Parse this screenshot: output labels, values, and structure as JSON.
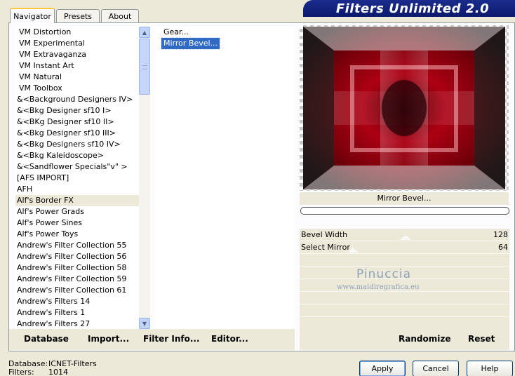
{
  "tabs": [
    {
      "label": "Navigator"
    },
    {
      "label": "Presets"
    },
    {
      "label": "About"
    }
  ],
  "banner_title": "Filters Unlimited 2.0",
  "categories": [
    {
      "label": "VM Distortion"
    },
    {
      "label": "VM Experimental"
    },
    {
      "label": "VM Extravaganza"
    },
    {
      "label": "VM Instant Art"
    },
    {
      "label": "VM Natural"
    },
    {
      "label": "VM Toolbox"
    },
    {
      "label": "&<Background Designers IV>"
    },
    {
      "label": "&<Bkg Designer sf10 I>"
    },
    {
      "label": "&<BKg Designer sf10 II>"
    },
    {
      "label": "&<Bkg Designer sf10 III>"
    },
    {
      "label": "&<Bkg Designers sf10 IV>"
    },
    {
      "label": "&<Bkg Kaleidoscope>"
    },
    {
      "label": "&<Sandflower Specials\"v\" >"
    },
    {
      "label": "[AFS IMPORT]"
    },
    {
      "label": "AFH"
    },
    {
      "label": "Alf's Border FX"
    },
    {
      "label": "Alf's Power Grads"
    },
    {
      "label": "Alf's Power Sines"
    },
    {
      "label": "Alf's Power Toys"
    },
    {
      "label": "Andrew's Filter Collection 55"
    },
    {
      "label": "Andrew's Filter Collection 56"
    },
    {
      "label": "Andrew's Filter Collection 58"
    },
    {
      "label": "Andrew's Filter Collection 59"
    },
    {
      "label": "Andrew's Filter Collection 61"
    },
    {
      "label": "Andrew's Filters 14"
    },
    {
      "label": "Andrew's Filters 1"
    },
    {
      "label": "Andrew's Filters 27"
    }
  ],
  "selected_category_index": 15,
  "filters": [
    {
      "label": "Gear..."
    },
    {
      "label": "Mirror Bevel..."
    }
  ],
  "selected_filter_index": 1,
  "current_filter_name": "Mirror Bevel...",
  "params": [
    {
      "label": "Bevel Width",
      "value": "128",
      "fraction": 0.5
    },
    {
      "label": "Select Mirror",
      "value": "64",
      "fraction": 0.0
    }
  ],
  "watermark": {
    "name": "Pinuccia",
    "site": "www.maidiregrafica.eu"
  },
  "toolbar": {
    "database": "Database",
    "import": "Import...",
    "filter_info": "Filter Info...",
    "editor": "Editor...",
    "randomize": "Randomize",
    "reset": "Reset"
  },
  "status": {
    "database_key": "Database:",
    "database_value": "ICNET-Filters",
    "filters_key": "Filters:",
    "filters_value": "1014"
  },
  "buttons": {
    "apply": "Apply",
    "cancel": "Cancel",
    "help": "Help"
  },
  "colors": {
    "selection": "#316ac5",
    "banner": "#0c1a6c",
    "preview_red": "#b00010"
  }
}
